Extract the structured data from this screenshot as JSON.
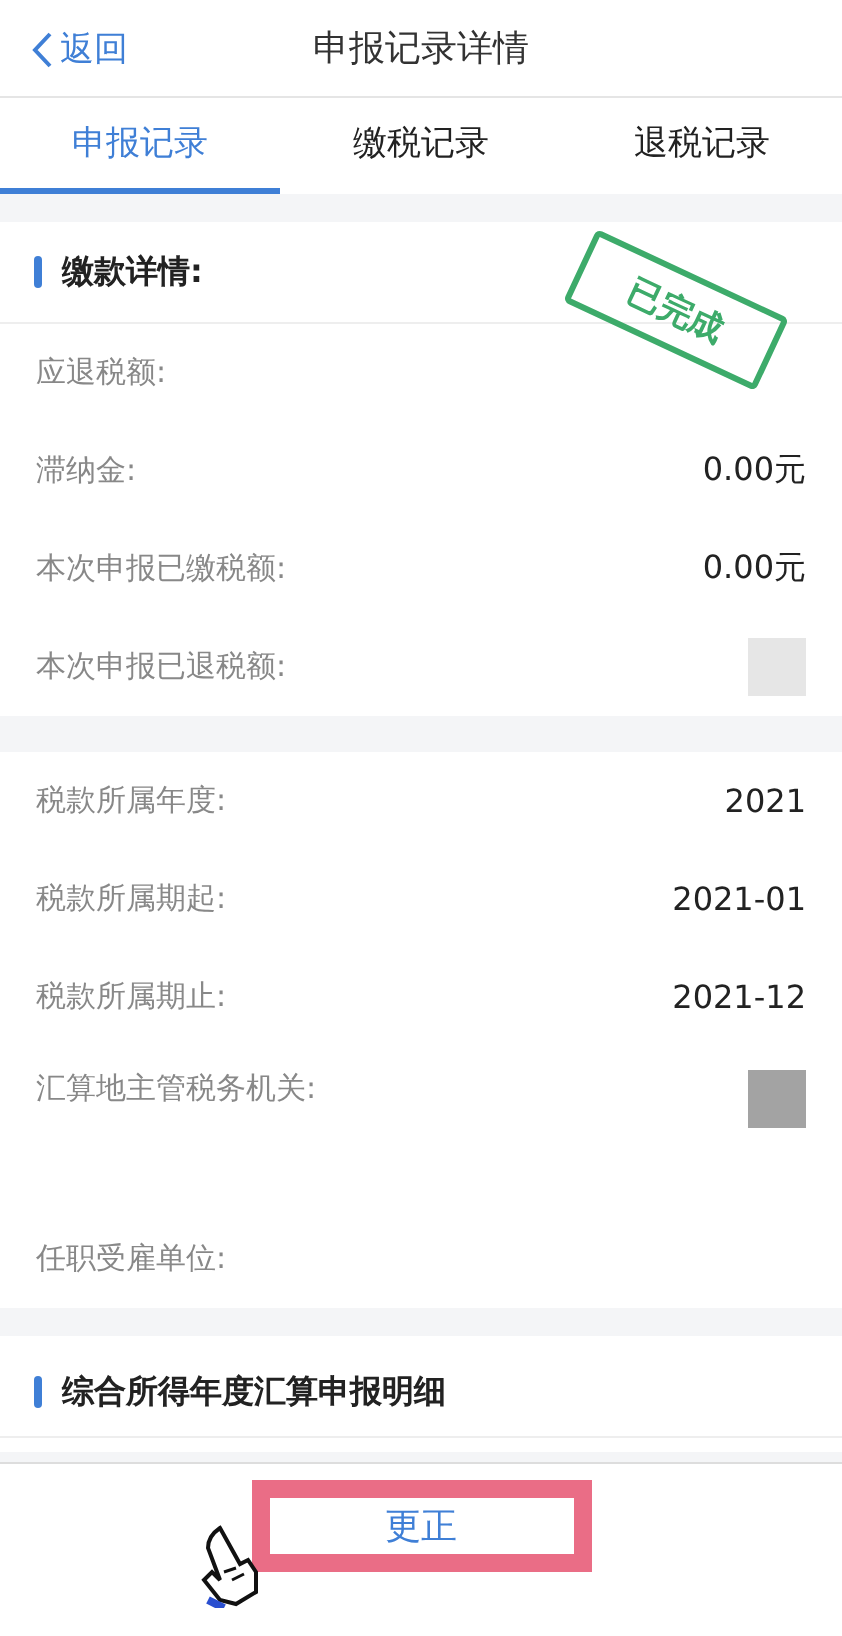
{
  "header": {
    "back": "返回",
    "title": "申报记录详情"
  },
  "tabs": [
    {
      "label": "申报记录",
      "selected": true
    },
    {
      "label": "缴税记录",
      "selected": false
    },
    {
      "label": "退税记录",
      "selected": false
    }
  ],
  "payment_section": {
    "title": "缴款详情:",
    "stamp": "已完成",
    "rows": [
      {
        "kind": "text",
        "label": "应退税额:"
      },
      {
        "kind": "text",
        "label": "滞纳金:",
        "value": "0.00元"
      },
      {
        "kind": "text",
        "label": "本次申报已缴税额:",
        "value": "0.00元"
      },
      {
        "kind": "masked",
        "label": "本次申报已退税额:",
        "color": "#e6e6e6"
      }
    ]
  },
  "period_section": {
    "rows": [
      {
        "kind": "text",
        "label": "税款所属年度:",
        "value": "2021"
      },
      {
        "kind": "text",
        "label": "税款所属期起:",
        "value": "2021-01"
      },
      {
        "kind": "text",
        "label": "税款所属期止:",
        "value": "2021-12"
      },
      {
        "kind": "masked",
        "label": "汇算地主管税务机关:",
        "color": "#a3a3a3"
      },
      {
        "kind": "text",
        "label": "任职受雇单位:"
      }
    ]
  },
  "detail_section": {
    "title": "综合所得年度汇算申报明细"
  },
  "footer": {
    "button": "更正",
    "highlighted": true
  }
}
